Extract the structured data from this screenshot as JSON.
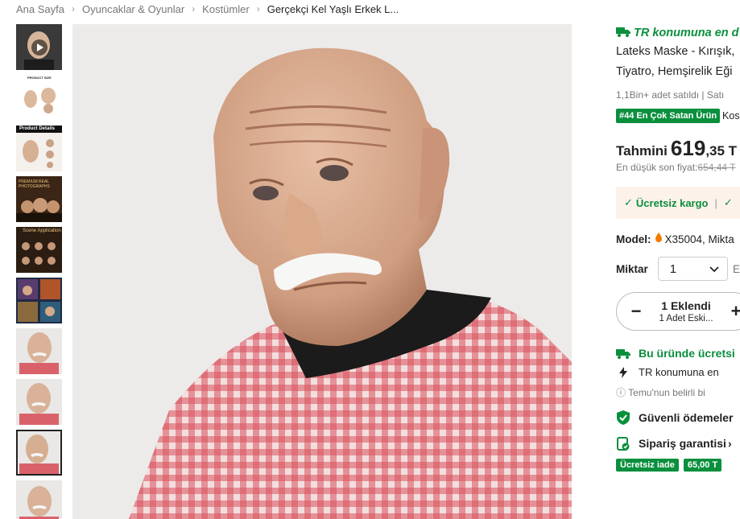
{
  "breadcrumb": {
    "items": [
      "Ana Sayfa",
      "Oyuncaklar & Oyunlar",
      "Kostümler",
      "Gerçekçi Kel Yaşlı Erkek L..."
    ],
    "separator": "›"
  },
  "thumbnails": {
    "items": [
      {
        "type": "video"
      },
      {
        "type": "image",
        "caption": "PRODUCT SIZE"
      },
      {
        "type": "image",
        "caption": "Product Details"
      },
      {
        "type": "image",
        "caption": "PREMIUM REAL PHOTOGRAPHS"
      },
      {
        "type": "image",
        "caption": "Scene Application"
      },
      {
        "type": "image",
        "caption": ""
      },
      {
        "type": "image",
        "caption": ""
      },
      {
        "type": "image",
        "caption": ""
      },
      {
        "type": "image",
        "caption": "",
        "active": true
      },
      {
        "type": "image",
        "caption": ""
      }
    ]
  },
  "main_image": {
    "icon": "old-man-mask-photo"
  },
  "product": {
    "shipping_banner": "TR konumuna en d",
    "title_line1": "Lateks Maske - Kırışık,",
    "title_line2": "Tiyatro, Hemşirelik Eği",
    "sold": "1,1Bin+ adet satıldı",
    "sold_sep": "|",
    "sold_tail": "Satı",
    "rank_badge": "#44 En Çok Satan Ürün",
    "rank_tail": "Kos",
    "price_label": "Tahmini",
    "price_int": "619",
    "price_dec": ",35 T",
    "lowest_label": "En düşük son fiyat:",
    "lowest_value": "654,44 T",
    "perk1": "Ücretsiz kargo",
    "perk_sep": "|",
    "model_label": "Model:",
    "model_value": "X35004, Mikta",
    "qty_label": "Miktar",
    "qty_value": "1",
    "qty_extra": "E",
    "cart_added": "1 Eklendi",
    "cart_sub": "1 Adet Eski...",
    "free_ship": "Bu üründe ücretsi",
    "tr_location": "TR konumuna en",
    "temu_note": "Temu'nun belirli bi",
    "secure_pay": "Güvenli ödemeler",
    "order_guarantee": "Sipariş garantisi",
    "free_return": "Ücretsiz iade",
    "credit": "65,00 T"
  },
  "colors": {
    "accent_green": "#0a8f3d",
    "orange": "#f07c00",
    "perk_bg": "#fdf2e9"
  }
}
